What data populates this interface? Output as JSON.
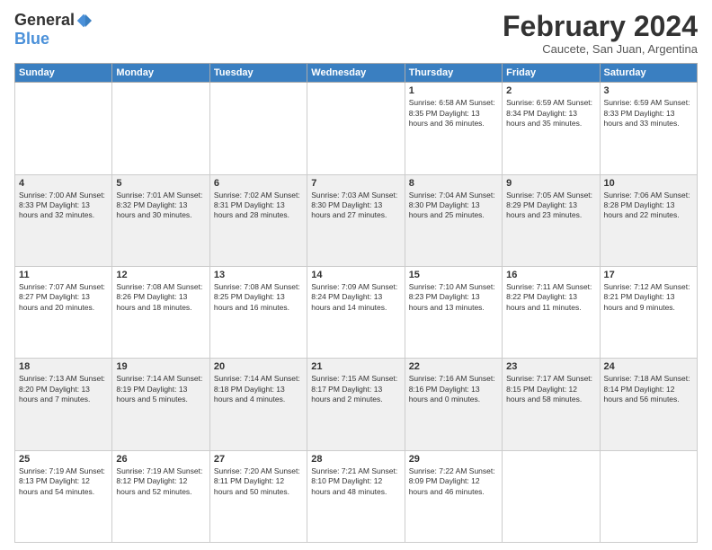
{
  "header": {
    "logo": {
      "general": "General",
      "blue": "Blue"
    },
    "title": "February 2024",
    "subtitle": "Caucete, San Juan, Argentina"
  },
  "days_of_week": [
    "Sunday",
    "Monday",
    "Tuesday",
    "Wednesday",
    "Thursday",
    "Friday",
    "Saturday"
  ],
  "weeks": [
    [
      {
        "day": "",
        "info": ""
      },
      {
        "day": "",
        "info": ""
      },
      {
        "day": "",
        "info": ""
      },
      {
        "day": "",
        "info": ""
      },
      {
        "day": "1",
        "info": "Sunrise: 6:58 AM\nSunset: 8:35 PM\nDaylight: 13 hours and 36 minutes."
      },
      {
        "day": "2",
        "info": "Sunrise: 6:59 AM\nSunset: 8:34 PM\nDaylight: 13 hours and 35 minutes."
      },
      {
        "day": "3",
        "info": "Sunrise: 6:59 AM\nSunset: 8:33 PM\nDaylight: 13 hours and 33 minutes."
      }
    ],
    [
      {
        "day": "4",
        "info": "Sunrise: 7:00 AM\nSunset: 8:33 PM\nDaylight: 13 hours and 32 minutes."
      },
      {
        "day": "5",
        "info": "Sunrise: 7:01 AM\nSunset: 8:32 PM\nDaylight: 13 hours and 30 minutes."
      },
      {
        "day": "6",
        "info": "Sunrise: 7:02 AM\nSunset: 8:31 PM\nDaylight: 13 hours and 28 minutes."
      },
      {
        "day": "7",
        "info": "Sunrise: 7:03 AM\nSunset: 8:30 PM\nDaylight: 13 hours and 27 minutes."
      },
      {
        "day": "8",
        "info": "Sunrise: 7:04 AM\nSunset: 8:30 PM\nDaylight: 13 hours and 25 minutes."
      },
      {
        "day": "9",
        "info": "Sunrise: 7:05 AM\nSunset: 8:29 PM\nDaylight: 13 hours and 23 minutes."
      },
      {
        "day": "10",
        "info": "Sunrise: 7:06 AM\nSunset: 8:28 PM\nDaylight: 13 hours and 22 minutes."
      }
    ],
    [
      {
        "day": "11",
        "info": "Sunrise: 7:07 AM\nSunset: 8:27 PM\nDaylight: 13 hours and 20 minutes."
      },
      {
        "day": "12",
        "info": "Sunrise: 7:08 AM\nSunset: 8:26 PM\nDaylight: 13 hours and 18 minutes."
      },
      {
        "day": "13",
        "info": "Sunrise: 7:08 AM\nSunset: 8:25 PM\nDaylight: 13 hours and 16 minutes."
      },
      {
        "day": "14",
        "info": "Sunrise: 7:09 AM\nSunset: 8:24 PM\nDaylight: 13 hours and 14 minutes."
      },
      {
        "day": "15",
        "info": "Sunrise: 7:10 AM\nSunset: 8:23 PM\nDaylight: 13 hours and 13 minutes."
      },
      {
        "day": "16",
        "info": "Sunrise: 7:11 AM\nSunset: 8:22 PM\nDaylight: 13 hours and 11 minutes."
      },
      {
        "day": "17",
        "info": "Sunrise: 7:12 AM\nSunset: 8:21 PM\nDaylight: 13 hours and 9 minutes."
      }
    ],
    [
      {
        "day": "18",
        "info": "Sunrise: 7:13 AM\nSunset: 8:20 PM\nDaylight: 13 hours and 7 minutes."
      },
      {
        "day": "19",
        "info": "Sunrise: 7:14 AM\nSunset: 8:19 PM\nDaylight: 13 hours and 5 minutes."
      },
      {
        "day": "20",
        "info": "Sunrise: 7:14 AM\nSunset: 8:18 PM\nDaylight: 13 hours and 4 minutes."
      },
      {
        "day": "21",
        "info": "Sunrise: 7:15 AM\nSunset: 8:17 PM\nDaylight: 13 hours and 2 minutes."
      },
      {
        "day": "22",
        "info": "Sunrise: 7:16 AM\nSunset: 8:16 PM\nDaylight: 13 hours and 0 minutes."
      },
      {
        "day": "23",
        "info": "Sunrise: 7:17 AM\nSunset: 8:15 PM\nDaylight: 12 hours and 58 minutes."
      },
      {
        "day": "24",
        "info": "Sunrise: 7:18 AM\nSunset: 8:14 PM\nDaylight: 12 hours and 56 minutes."
      }
    ],
    [
      {
        "day": "25",
        "info": "Sunrise: 7:19 AM\nSunset: 8:13 PM\nDaylight: 12 hours and 54 minutes."
      },
      {
        "day": "26",
        "info": "Sunrise: 7:19 AM\nSunset: 8:12 PM\nDaylight: 12 hours and 52 minutes."
      },
      {
        "day": "27",
        "info": "Sunrise: 7:20 AM\nSunset: 8:11 PM\nDaylight: 12 hours and 50 minutes."
      },
      {
        "day": "28",
        "info": "Sunrise: 7:21 AM\nSunset: 8:10 PM\nDaylight: 12 hours and 48 minutes."
      },
      {
        "day": "29",
        "info": "Sunrise: 7:22 AM\nSunset: 8:09 PM\nDaylight: 12 hours and 46 minutes."
      },
      {
        "day": "",
        "info": ""
      },
      {
        "day": "",
        "info": ""
      }
    ]
  ]
}
